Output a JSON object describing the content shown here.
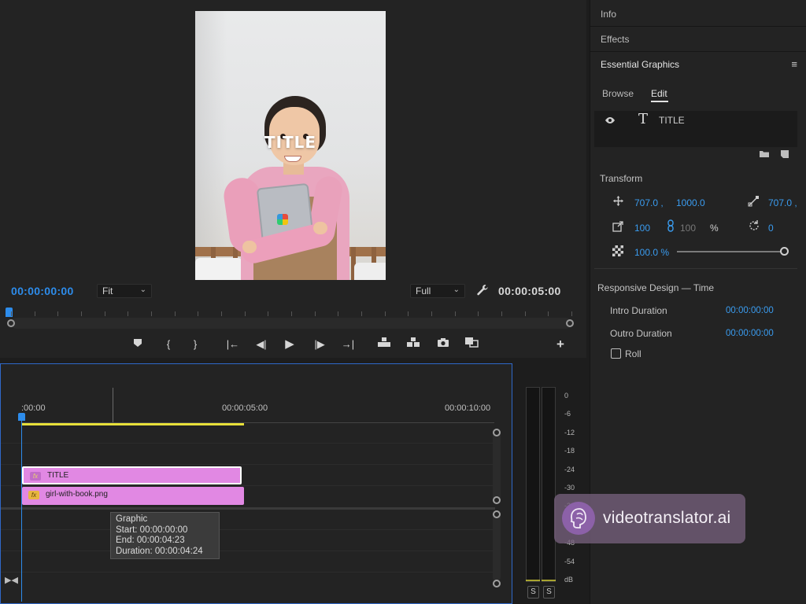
{
  "program_monitor": {
    "video_title_text": "TITLE",
    "current_time": "00:00:00:00",
    "zoom_select": "Fit",
    "resolution_select": "Full",
    "duration": "00:00:05:00"
  },
  "right_panel": {
    "tabs": [
      "Info",
      "Effects"
    ],
    "essential_graphics": {
      "title": "Essential Graphics",
      "menu_icon": "hamburger-menu-icon",
      "subtabs": [
        "Browse",
        "Edit"
      ],
      "active_subtab": "Edit",
      "layer": {
        "name": "TITLE",
        "type_icon": "text-layer-icon"
      },
      "transform": {
        "label": "Transform",
        "position_x": "707.0 ,",
        "position_y": "1000.0",
        "anchor_x": "707.0 ,",
        "scale": "100",
        "scale_linked": "100",
        "scale_unit": "%",
        "rotation": "0",
        "opacity": "100.0 %",
        "opacity_level_percent": 100
      },
      "responsive_design": {
        "label": "Responsive Design — Time",
        "intro_label": "Intro Duration",
        "intro_value": "00:00:00:00",
        "outro_label": "Outro Duration",
        "outro_value": "00:00:00:00",
        "roll_label": "Roll",
        "roll_checked": false
      }
    }
  },
  "timeline": {
    "time_labels": [
      ":00:00",
      "00:00:05:00",
      "00:00:10:00"
    ],
    "clips": [
      {
        "label": "TITLE",
        "fx": "fx"
      },
      {
        "label": "girl-with-book.png",
        "fx": "fx"
      }
    ],
    "tooltip": {
      "line1": "Graphic",
      "line2": "Start: 00:00:00:00",
      "line3": "End: 00:00:04:23",
      "line4": "Duration: 00:00:04:24"
    }
  },
  "audio_meter": {
    "scale": [
      "0",
      "-6",
      "-12",
      "-18",
      "-24",
      "-30",
      "-36",
      "-42",
      "-48",
      "-54",
      "dB"
    ],
    "solo_buttons": [
      "S",
      "S"
    ]
  },
  "watermark": {
    "text": "videotranslator.ai"
  },
  "colors": {
    "accent_blue": "#2d8ceb",
    "clip_pink": "#e188e3",
    "work_area_yellow": "#e7e03a",
    "panel_bg": "#232323"
  }
}
